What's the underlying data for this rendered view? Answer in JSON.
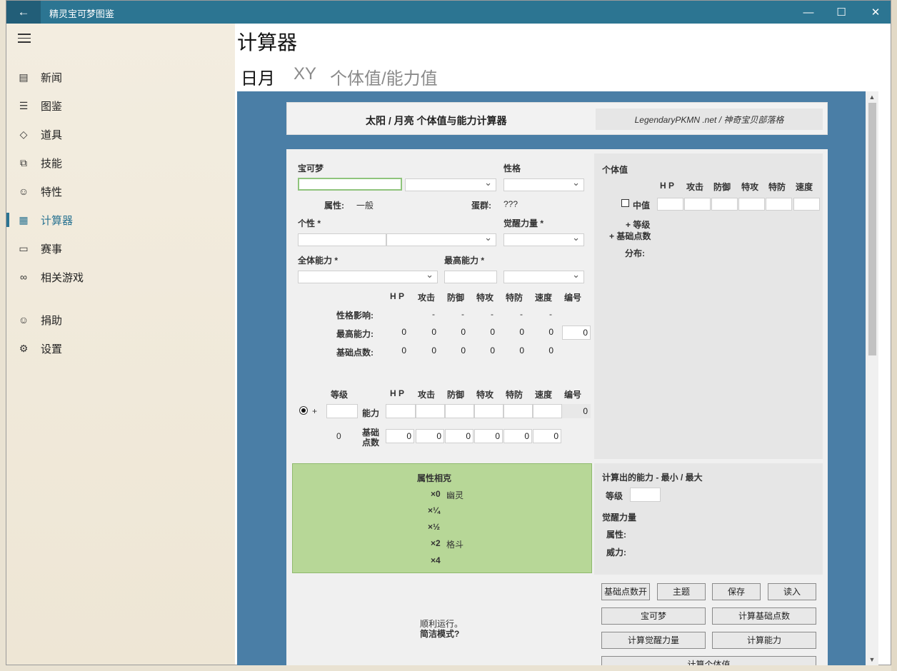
{
  "window": {
    "title": "精灵宝可梦图鉴"
  },
  "sidebar": {
    "items": [
      {
        "label": "新闻",
        "icon": "newspaper-icon"
      },
      {
        "label": "图鉴",
        "icon": "list-icon"
      },
      {
        "label": "道具",
        "icon": "tag-icon"
      },
      {
        "label": "技能",
        "icon": "skill-icon"
      },
      {
        "label": "特性",
        "icon": "smile-icon"
      },
      {
        "label": "计算器",
        "icon": "calculator-icon",
        "active": true
      },
      {
        "label": "赛事",
        "icon": "chat-icon"
      },
      {
        "label": "相关游戏",
        "icon": "link-icon"
      }
    ],
    "bottom_items": [
      {
        "label": "捐助",
        "icon": "smiley-icon"
      },
      {
        "label": "设置",
        "icon": "gear-icon"
      }
    ]
  },
  "page": {
    "title": "计算器",
    "tabs": [
      "日月",
      "XY",
      "个体值/能力值"
    ]
  },
  "calc": {
    "header_title": "太阳 / 月亮 个体值与能力计算器",
    "header_credit": "LegendaryPKMN .net / 神奇宝贝部落格",
    "pokemon_label": "宝可梦",
    "nature_label": "性格",
    "type_label": "属性:",
    "type_value": "一般",
    "egg_label": "蛋群:",
    "egg_value": "???",
    "characteristic_label": "个性 *",
    "hidden_power_label": "觉醒力量 *",
    "overall_label": "全体能力 *",
    "highest_label": "最高能力 *",
    "stat_headers": [
      "H P",
      "攻击",
      "防御",
      "特攻",
      "特防",
      "速度",
      "编号"
    ],
    "nature_effect_label": "性格影响:",
    "nature_effects": [
      "-",
      "-",
      "-",
      "-",
      "-"
    ],
    "max_stat_label": "最高能力:",
    "max_stats": [
      "0",
      "0",
      "0",
      "0",
      "0",
      "0"
    ],
    "max_stat_id": "0",
    "base_ev_label": "基础点数:",
    "base_evs": [
      "0",
      "0",
      "0",
      "0",
      "0",
      "0"
    ],
    "level_label": "等级",
    "plus": "+",
    "stat_row_label": "能力",
    "stat_row_id": "0",
    "ev_row_label_1": "基础",
    "ev_row_label_2": "点数",
    "ev_total": "0",
    "ev_inputs": [
      "0",
      "0",
      "0",
      "0",
      "0",
      "0"
    ],
    "iv_title": "个体值",
    "iv_headers": [
      "H P",
      "攻击",
      "防御",
      "特攻",
      "特防",
      "速度"
    ],
    "iv_mid_label": "中值",
    "iv_level_label": "+ 等级",
    "iv_ev_label": "+ 基础点数",
    "iv_dist_label": "分布:",
    "type_chart_title": "属性相克",
    "type_chart": [
      {
        "mult": "×0",
        "types": "幽灵"
      },
      {
        "mult": "×¼",
        "types": ""
      },
      {
        "mult": "×½",
        "types": ""
      },
      {
        "mult": "×2",
        "types": "格斗"
      },
      {
        "mult": "×4",
        "types": ""
      }
    ],
    "computed_title": "计算出的能力 - 最小 / 最大",
    "computed_level_label": "等级",
    "computed_hp_title": "觉醒力量",
    "computed_type_label": "属性:",
    "computed_power_label": "威力:",
    "status_text_1": "顺利运行。",
    "status_text_2": "简洁模式?",
    "buttons": {
      "ev_toggle": "基础点数开",
      "theme": "主题",
      "save": "保存",
      "load": "读入",
      "pokemon": "宝可梦",
      "calc_ev": "计算基础点数",
      "calc_hp": "计算觉醒力量",
      "calc_stats": "计算能力",
      "calc_iv": "计算个体值"
    }
  }
}
